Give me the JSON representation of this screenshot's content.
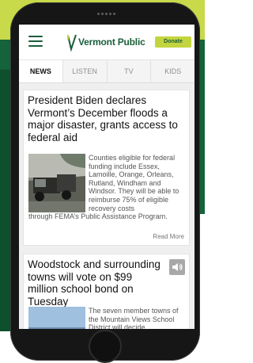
{
  "app": {
    "logo_text": "Vermont Public",
    "donate_label": "Donate"
  },
  "tabs": [
    {
      "label": "NEWS",
      "active": true
    },
    {
      "label": "LISTEN",
      "active": false
    },
    {
      "label": "TV",
      "active": false
    },
    {
      "label": "KIDS",
      "active": false
    }
  ],
  "stories": [
    {
      "headline": "President Biden declares Vermont’s December floods a major disaster, grants access to federal aid",
      "summary_side": "Counties eligible for federal funding include Essex, Lamoille, Orange, Orleans, Rutland, Windham and Windsor. They will be able to reimburse 75% of eligible recovery costs",
      "summary_full": "through FEMA’s Public Assistance Program.",
      "read_more": "Read More"
    },
    {
      "headline": "Woodstock and surrounding towns will vote on $99 million school bond on Tuesday",
      "summary_side": "The seven member towns of the Mountain Views School District will decide"
    }
  ],
  "colors": {
    "brand_green": "#1b5e3a",
    "accent_lime": "#c3d53e"
  }
}
